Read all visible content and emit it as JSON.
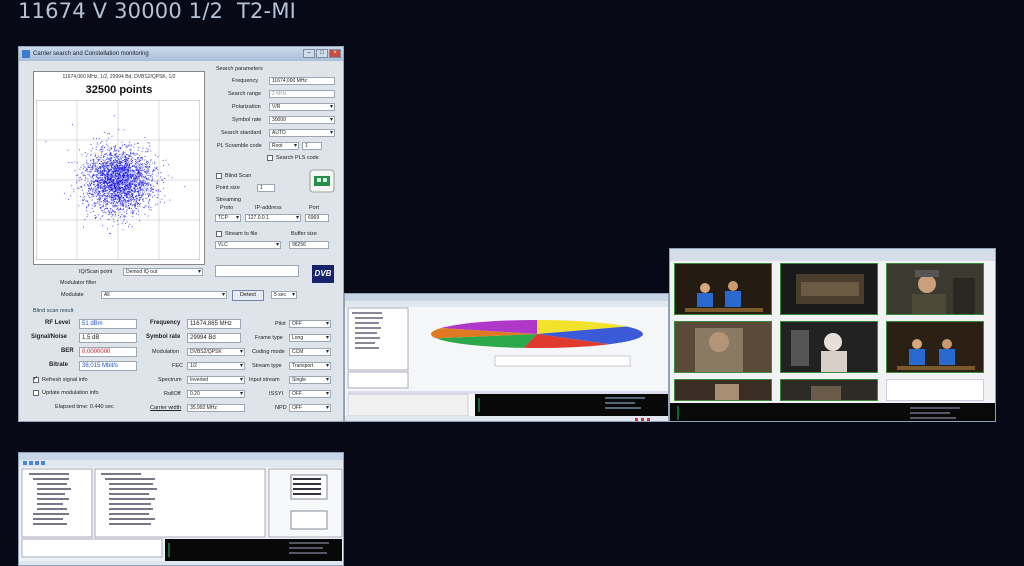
{
  "header": {
    "title": "11674 V 30000 1/2  T2-MI"
  },
  "main_window": {
    "title": "Carrier search and Constellation monitoring",
    "constellation": {
      "info_line": "11674,060 MHz, 1/2, 29994 Bd, DVBS2/QPSK, 1/2",
      "points": "32500 points",
      "color": "#1a1ae6"
    },
    "search": {
      "header": "Search parameters",
      "frequency_label": "Frequency",
      "frequency_value": "11674,000 MHz",
      "search_range_label": "Search range",
      "search_range_value": "2 MHz",
      "polarization_label": "Polarization",
      "polarization_value": "V/R",
      "symbol_rate_label": "Symbol rate",
      "symbol_rate_value": "30000",
      "search_standard_label": "Search standard",
      "search_standard_value": "AUTO",
      "pl_scramble_label": "PL Scramble code",
      "pl_scramble_value": "Root",
      "pl_scramble_num": "1",
      "search_pls_label": "Search PLS code",
      "blind_scan_label": "Blind Scan",
      "point_size_label": "Point size",
      "point_size_value": "1",
      "streaming_label": "Streaming",
      "protocol_label": "Proto",
      "protocol_value": "TCP",
      "ip_label": "IP-address",
      "ip_value": "127.0.0.1",
      "port_label": "Port",
      "port_value": "6969",
      "stream_to_file_label": "Stream to file",
      "buffer_label": "Buffer size",
      "buffer_value": "96256",
      "player_value": "VLC"
    },
    "iq": {
      "iq_point_label": "IQ/Scan point",
      "iq_point_value": "Demod IQ out",
      "modulator_filter_label": "Modulator filter",
      "modulate_label": "Modulate",
      "modulate_value": "All",
      "detect_button": "Detect",
      "sec_value": "5 sec"
    },
    "blind_result": {
      "header": "Blind scan result",
      "rf_level_label": "RF Level",
      "rf_level_value": "51 dBm",
      "signal_noise_label": "Signal/Noise",
      "signal_noise_value": "1,5 dB",
      "ber_label": "BER",
      "ber_value": "0,0000000",
      "bitrate_label": "Bitrate",
      "bitrate_value": "38,015 Mbit/s",
      "refresh_label": "Refresh signal info",
      "update_mod_label": "Update modulation info",
      "elapsed_label": "Elapsed time: 0.440 sec",
      "frequency_label": "Frequency",
      "frequency_value": "11674,865 MHz",
      "symbol_rate_label": "Symbol rate",
      "symbol_rate_value": "29994 Bd",
      "modulation_label": "Modulation",
      "modulation_value": "DVBS2/QPSK",
      "fec_label": "FEC",
      "fec_value": "1/2",
      "spectrum_label": "Spectrum",
      "spectrum_value": "Inverted",
      "rolloff_label": "RollOff",
      "rolloff_value": "0.20",
      "carrier_width_label": "Carrier width",
      "carrier_width_value": "35,992 MHz",
      "pilot_label": "Pilot",
      "pilot_value": "OFF",
      "frame_type_label": "Frame type",
      "frame_type_value": "Long",
      "coding_mode_label": "Coding mode",
      "coding_mode_value": "CCM",
      "stream_type_label": "Stream type",
      "stream_type_value": "Transport",
      "input_stream_label": "Input stream",
      "input_stream_value": "Single",
      "issyi_label": "ISSYI",
      "issyi_value": "OFF",
      "npd_label": "NPD",
      "npd_value": "OFF"
    },
    "dvb_logo": "DVB"
  },
  "thumbnails": {
    "pie_colors": [
      "#f2e22b",
      "#3a5ad8",
      "#e03a2f",
      "#2aa84a",
      "#e07a22",
      "#b038c8"
    ]
  }
}
